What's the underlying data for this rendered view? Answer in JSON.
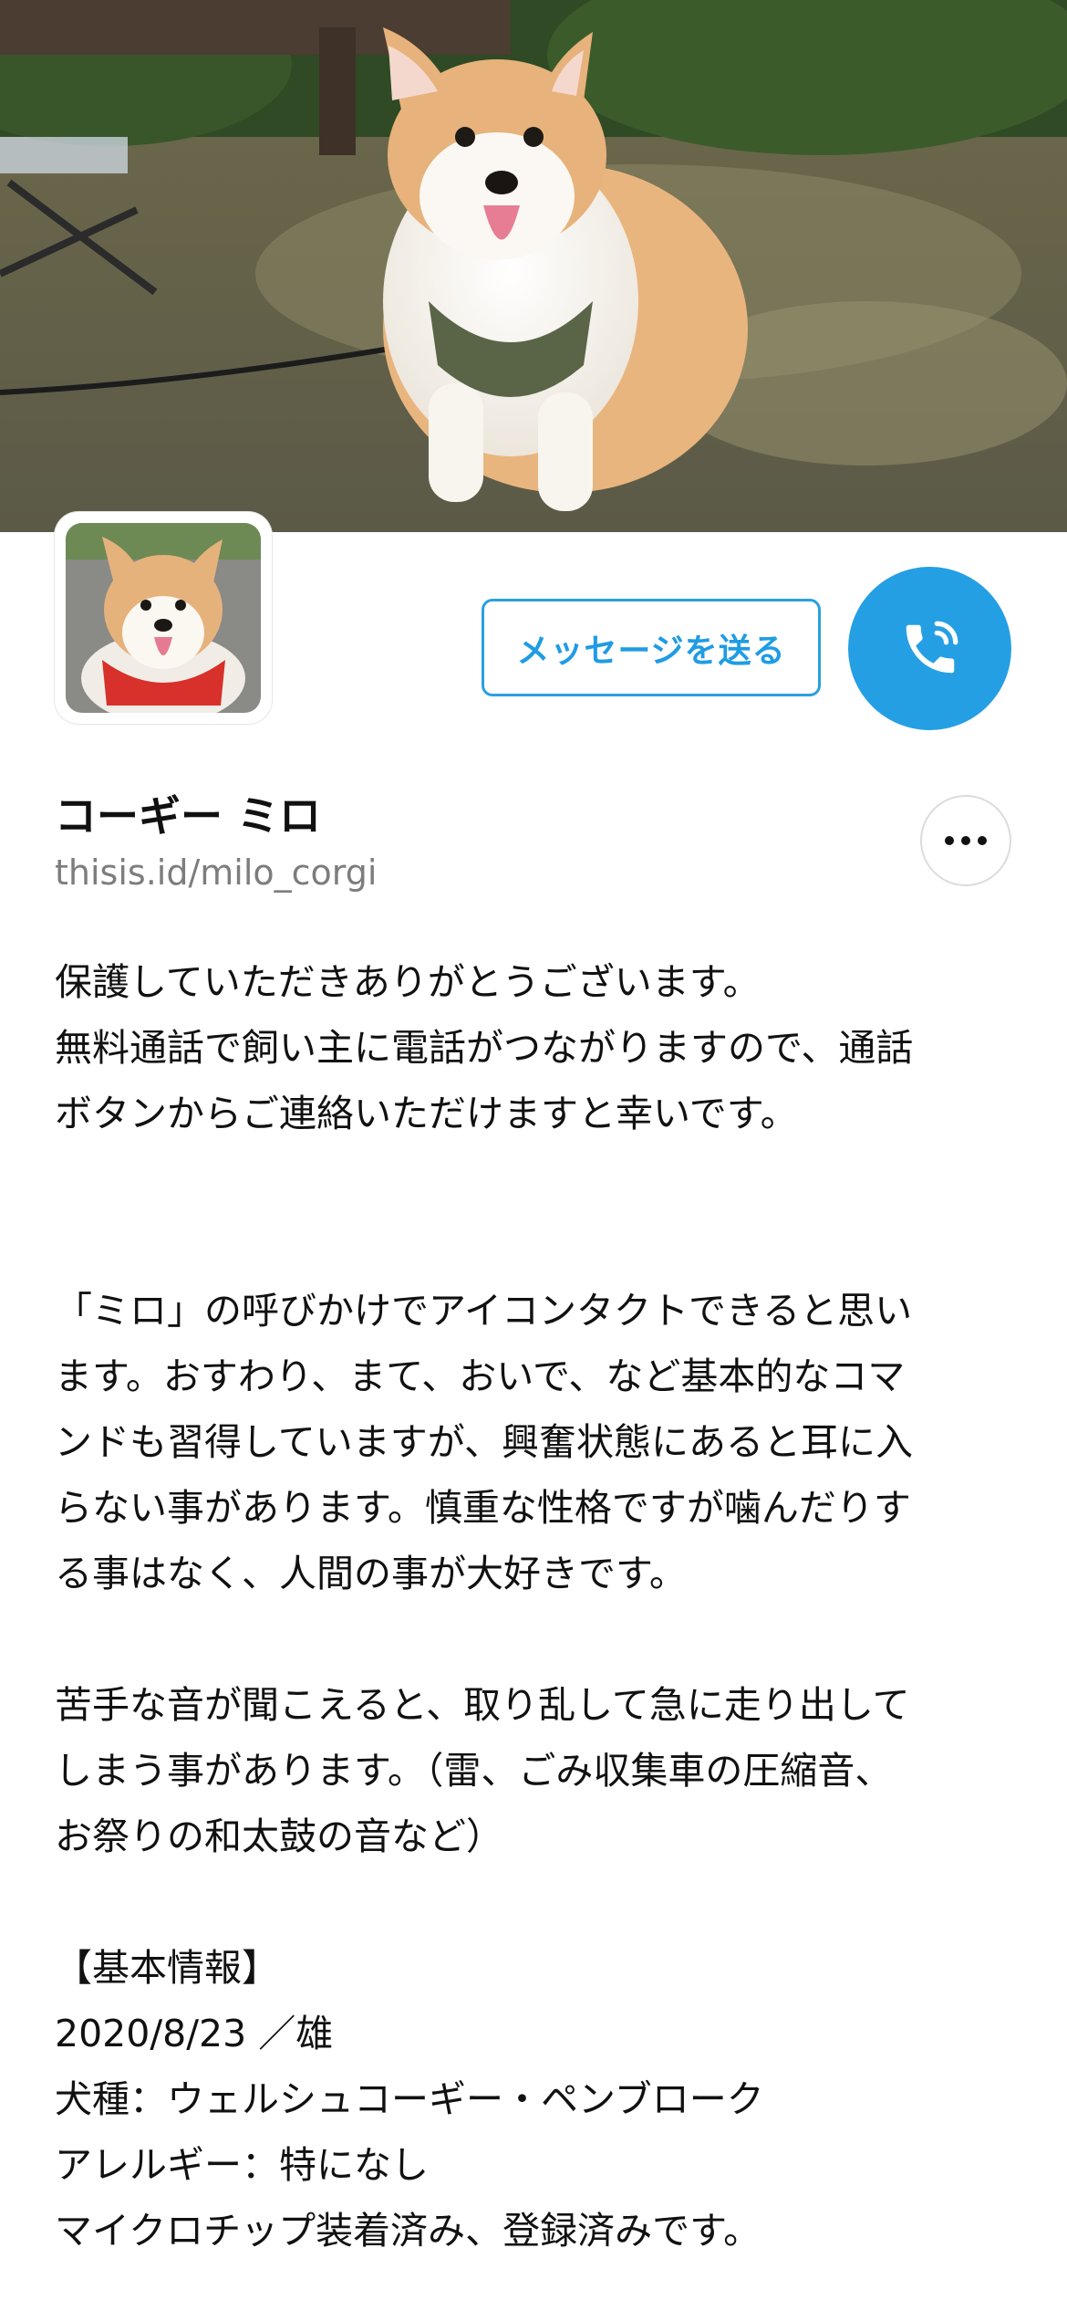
{
  "profile": {
    "name": "コーギー ミロ",
    "handle": "thisis.id/milo_corgi",
    "message_button": "メッセージを送る"
  },
  "icons": {
    "call": "phone-call-icon",
    "more": "more-horizontal-icon",
    "cover": "corgi-cover-photo",
    "avatar": "corgi-avatar-photo"
  },
  "colors": {
    "accent": "#259fe4",
    "text": "#111111",
    "muted": "#7d7d7d"
  },
  "bio": {
    "p1": [
      "保護していただきありがとうございます。",
      "無料通話で飼い主に電話がつながりますので、通話",
      "ボタンからご連絡いただけますと幸いです。"
    ],
    "p2": [
      "「ミロ」の呼びかけでアイコンタクトできると思い",
      "ます。おすわり、まて、おいで、など基本的なコマ",
      "ンドも習得していますが、興奮状態にあると耳に入",
      "らない事があります。慎重な性格ですが噛んだりす",
      "る事はなく、人間の事が大好きです。"
    ],
    "p3": [
      "苦手な音が聞こえると、取り乱して急に走り出して",
      "しまう事があります。（雷、ごみ収集車の圧縮音、",
      "お祭りの和太鼓の音など）"
    ],
    "p4": [
      "【基本情報】",
      "2020/8/23 ／雄",
      "犬種：ウェルシュコーギー・ペンブローク",
      "アレルギー：特になし",
      "マイクロチップ装着済み、登録済みです。"
    ]
  }
}
